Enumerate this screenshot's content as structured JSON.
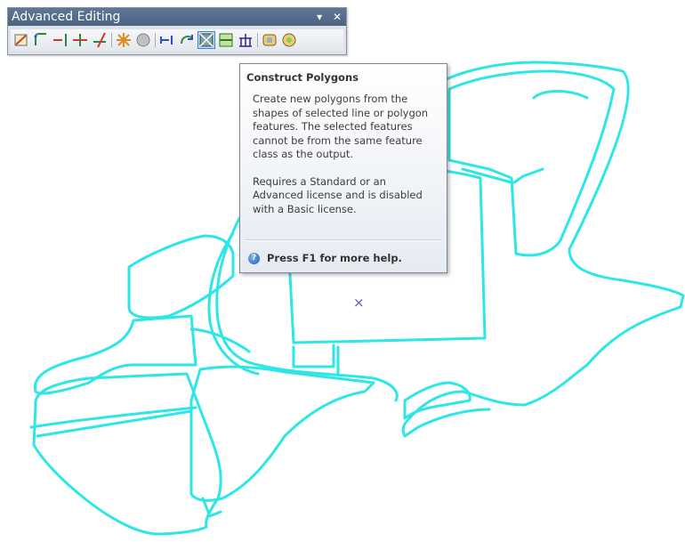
{
  "toolbar": {
    "title": "Advanced Editing",
    "dropdown_glyph": "▾",
    "close_glyph": "✕",
    "tools": [
      {
        "name": "copy-features-icon"
      },
      {
        "name": "fillet-icon"
      },
      {
        "name": "extend-icon"
      },
      {
        "name": "trim-icon"
      },
      {
        "name": "line-intersection-icon"
      },
      {
        "name": "explode-multipart-icon"
      },
      {
        "name": "generalize-icon"
      },
      {
        "name": "align-to-shape-icon"
      },
      {
        "name": "replace-geometry-icon"
      },
      {
        "name": "construct-polygons-icon",
        "active": true
      },
      {
        "name": "split-polygons-icon"
      },
      {
        "name": "construct-geodetic-icon"
      },
      {
        "name": "buffer-icon"
      },
      {
        "name": "smooth-icon"
      }
    ]
  },
  "tooltip": {
    "title": "Construct Polygons",
    "description": "Create new polygons from the shapes of selected line or polygon features. The selected features cannot be from the same feature class as the output.",
    "license_note": "Requires a Standard or an Advanced license and is disabled with a Basic license.",
    "help_text": "Press F1 for more help.",
    "help_glyph": "?"
  },
  "map": {
    "feature_color": "#2ee6e6",
    "cursor_glyph": "×"
  }
}
